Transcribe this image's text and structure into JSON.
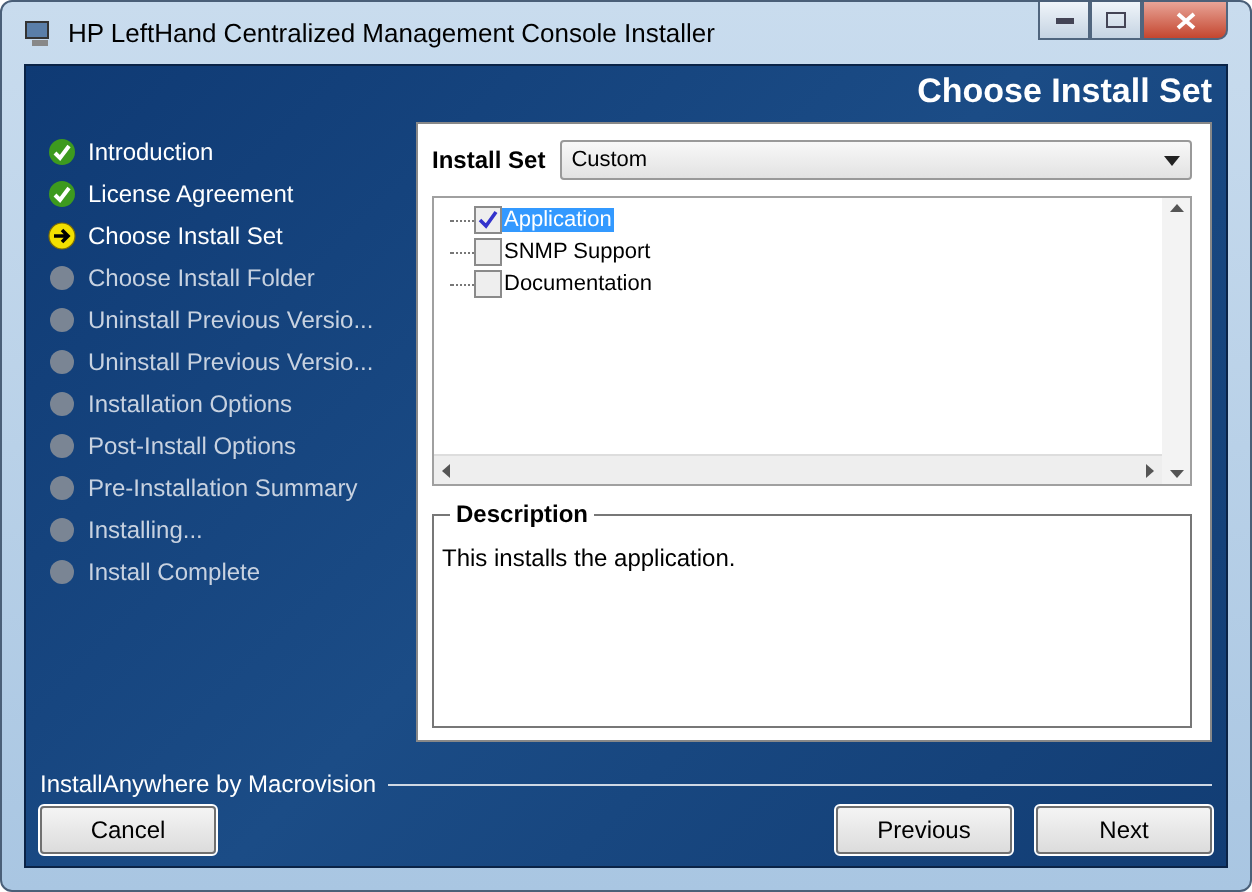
{
  "window": {
    "title": "HP LeftHand Centralized Management Console Installer"
  },
  "header": {
    "title": "Choose Install Set"
  },
  "steps": [
    {
      "label": "Introduction",
      "kind": "done"
    },
    {
      "label": "License Agreement",
      "kind": "done"
    },
    {
      "label": "Choose Install Set",
      "kind": "current"
    },
    {
      "label": "Choose Install Folder",
      "kind": "pending"
    },
    {
      "label": "Uninstall Previous Versio...",
      "kind": "pending"
    },
    {
      "label": "Uninstall Previous Versio...",
      "kind": "pending"
    },
    {
      "label": "Installation Options",
      "kind": "pending"
    },
    {
      "label": "Post-Install Options",
      "kind": "pending"
    },
    {
      "label": "Pre-Installation Summary",
      "kind": "pending"
    },
    {
      "label": "Installing...",
      "kind": "pending"
    },
    {
      "label": "Install Complete",
      "kind": "pending"
    }
  ],
  "install_set": {
    "label": "Install Set",
    "value": "Custom"
  },
  "features": [
    {
      "label": "Application",
      "checked": true,
      "selected": true
    },
    {
      "label": "SNMP Support",
      "checked": false,
      "selected": false
    },
    {
      "label": "Documentation",
      "checked": false,
      "selected": false
    }
  ],
  "description": {
    "title": "Description",
    "text": "This installs the application."
  },
  "footer": {
    "vendor": "InstallAnywhere by Macrovision"
  },
  "buttons": {
    "cancel": "Cancel",
    "previous": "Previous",
    "next": "Next"
  }
}
